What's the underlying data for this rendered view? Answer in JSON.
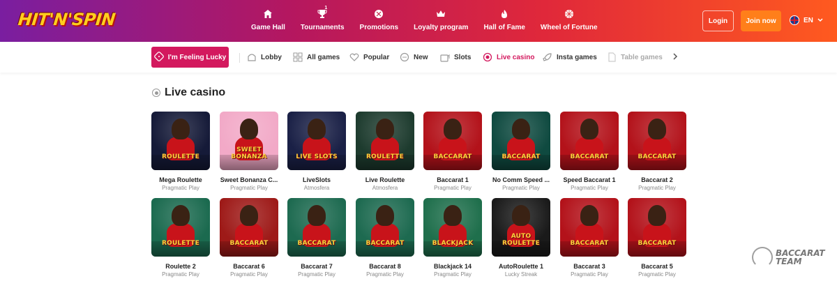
{
  "header": {
    "logo": "HIT'N'SPIN",
    "nav": [
      {
        "label": "Game Hall",
        "icon": "home-icon"
      },
      {
        "label": "Tournaments",
        "icon": "trophy-icon",
        "badge": "1"
      },
      {
        "label": "Promotions",
        "icon": "gift-icon"
      },
      {
        "label": "Loyalty program",
        "icon": "crown-icon"
      },
      {
        "label": "Hall of Fame",
        "icon": "flame-icon"
      },
      {
        "label": "Wheel of Fortune",
        "icon": "wheel-icon"
      }
    ],
    "login_label": "Login",
    "join_label": "Join now",
    "language": "EN"
  },
  "categories": {
    "lucky_label": "I'm Feeling Lucky",
    "items": [
      {
        "label": "Lobby",
        "icon": "lobby-icon"
      },
      {
        "label": "All games",
        "icon": "grid-icon"
      },
      {
        "label": "Popular",
        "icon": "heart-icon"
      },
      {
        "label": "New",
        "icon": "new-icon"
      },
      {
        "label": "Slots",
        "icon": "slots-icon"
      },
      {
        "label": "Live casino",
        "icon": "live-icon",
        "active": true
      },
      {
        "label": "Insta games",
        "icon": "rocket-icon"
      },
      {
        "label": "Table games",
        "icon": "table-icon"
      }
    ]
  },
  "section": {
    "title": "Live casino"
  },
  "games_row1": [
    {
      "name": "Mega Roulette",
      "provider": "Pragmatic Play",
      "art": "ROULETTE",
      "bg": "#151a38"
    },
    {
      "name": "Sweet Bonanza C...",
      "provider": "Pragmatic Play",
      "art": "SWEET BONANZA",
      "bg": "#f2a9c7"
    },
    {
      "name": "LiveSlots",
      "provider": "Atmosfera",
      "art": "LIVE SLOTS",
      "bg": "#1a2046"
    },
    {
      "name": "Live Roulette",
      "provider": "Atmosfera",
      "art": "ROULETTE",
      "bg": "#1d3b2e"
    },
    {
      "name": "Baccarat 1",
      "provider": "Pragmatic Play",
      "art": "BACCARAT",
      "bg": "#b3121a"
    },
    {
      "name": "No Comm Speed ...",
      "provider": "Pragmatic Play",
      "art": "BACCARAT",
      "bg": "#0f4a40"
    },
    {
      "name": "Speed Baccarat 1",
      "provider": "Pragmatic Play",
      "art": "BACCARAT",
      "bg": "#b3121a"
    },
    {
      "name": "Baccarat 2",
      "provider": "Pragmatic Play",
      "art": "BACCARAT",
      "bg": "#b3121a"
    }
  ],
  "games_row2": [
    {
      "name": "Roulette 2",
      "provider": "Pragmatic Play",
      "art": "ROULETTE",
      "bg": "#1b6a4f"
    },
    {
      "name": "Baccarat 6",
      "provider": "Pragmatic Play",
      "art": "BACCARAT",
      "bg": "#9e1a18"
    },
    {
      "name": "Baccarat 7",
      "provider": "Pragmatic Play",
      "art": "BACCARAT",
      "bg": "#1d6a50"
    },
    {
      "name": "Baccarat 8",
      "provider": "Pragmatic Play",
      "art": "BACCARAT",
      "bg": "#1d6a50"
    },
    {
      "name": "Blackjack 14",
      "provider": "Pragmatic Play",
      "art": "BLACKJACK",
      "bg": "#1f6f4c"
    },
    {
      "name": "AutoRoulette 1",
      "provider": "Lucky Streak",
      "art": "AUTO ROULETTE",
      "bg": "#1a1a1a"
    },
    {
      "name": "Baccarat 3",
      "provider": "Pragmatic Play",
      "art": "BACCARAT",
      "bg": "#b3121a"
    },
    {
      "name": "Baccarat 5",
      "provider": "Pragmatic Play",
      "art": "BACCARAT",
      "bg": "#b3121a"
    }
  ],
  "watermark": {
    "line1": "BACCARAT",
    "line2": "TEAM"
  }
}
